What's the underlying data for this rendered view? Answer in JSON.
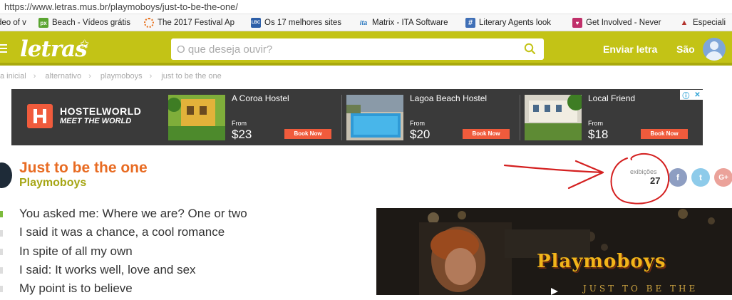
{
  "browser": {
    "url": "https://www.letras.mus.br/playmoboys/just-to-be-the-one/",
    "bookmarks": [
      {
        "label": "deo of v",
        "icon": "video-icon"
      },
      {
        "label": "Beach - Vídeos grátis",
        "icon": "px-icon",
        "icon_text": "px"
      },
      {
        "label": "The 2017 Festival Ap",
        "icon": "festival-icon"
      },
      {
        "label": "Os 17 melhores sites",
        "icon": "lbc-icon",
        "icon_text": "LBC"
      },
      {
        "label": "Matrix - ITA Software",
        "icon": "ita-icon",
        "icon_text": "ita"
      },
      {
        "label": "Literary Agents look",
        "icon": "hash-icon",
        "icon_text": "#"
      },
      {
        "label": "Get Involved - Never",
        "icon": "heart-icon"
      },
      {
        "label": "Especiali",
        "icon": "hat-icon"
      }
    ]
  },
  "header": {
    "logo": "letras",
    "search_placeholder": "O que deseja ouvir?",
    "send_lyrics": "Enviar letra",
    "user_name": "São",
    "accent": "#c3c316"
  },
  "breadcrumb": [
    "a inicial",
    "alternativo",
    "playmoboys",
    "just to be the one"
  ],
  "ad": {
    "brand": "HOSTELWORLD",
    "tagline": "MEET THE WORLD",
    "hostels": [
      {
        "name": "A Coroa Hostel",
        "from": "From",
        "price": "$23",
        "cta": "Book Now"
      },
      {
        "name": "Lagoa Beach Hostel",
        "from": "From",
        "price": "$20",
        "cta": "Book Now"
      },
      {
        "name": "Local Friend",
        "from": "From",
        "price": "$18",
        "cta": "Book Now"
      }
    ]
  },
  "song": {
    "title": "Just to be the one",
    "artist": "Playmoboys",
    "views_label": "exibições",
    "views": "27",
    "lyrics": [
      "You asked me: Where we are? One or two",
      "I said it was a chance, a cool romance",
      "In spite of all my own",
      "I said: It works well, love and sex",
      "My point is to believe"
    ]
  },
  "share": {
    "facebook": "f",
    "twitter": "t",
    "google": "G+"
  },
  "video": {
    "title": "Playmoboys",
    "subtitle": "JUST TO BE THE ONE"
  }
}
